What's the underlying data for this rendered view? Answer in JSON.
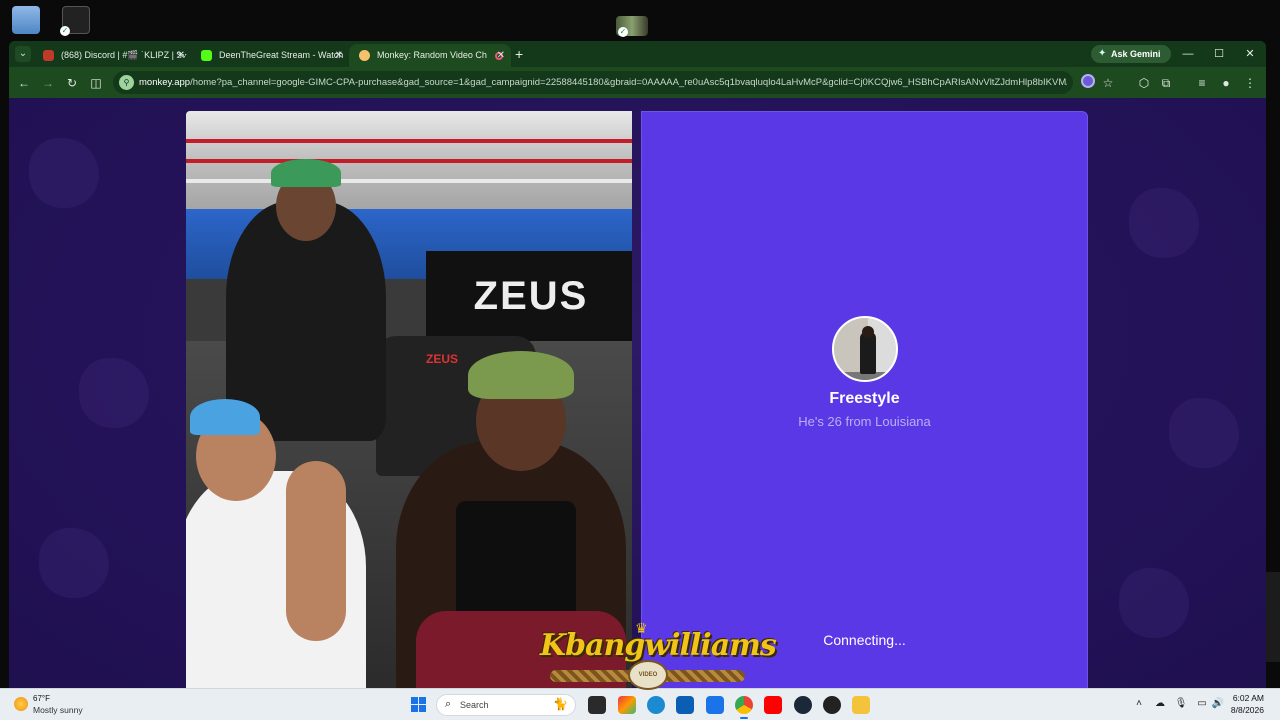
{
  "desktop": {
    "icons": [
      "recycle-bin-icon",
      "game-shortcut-icon",
      "video-thumbnail-icon"
    ]
  },
  "browser": {
    "tabs": [
      {
        "label": "(868) Discord | #🎬 ˙KLIPZ | Ꮥꭹ",
        "favicon_color": "#5865f2",
        "active": false
      },
      {
        "label": "DeenTheGreat Stream - Watch",
        "favicon_color": "#53fc18",
        "active": false
      },
      {
        "label": "Monkey: Random Video Ch",
        "favicon_color": "#f5c26b",
        "active": true
      }
    ],
    "new_tab": "+",
    "ask_gemini": "Ask Gemini",
    "url_host": "monkey.app",
    "url_path": "/home?pa_channel=google-GIMC-CPA-purchase&gad_source=1&gad_campaignid=22588445180&gbraid=0AAAAA_re0uAsc5q1bvaqluqlo4LaHvMcP&gclid=Cj0KCQjw6_HSBhCpARIsANvVltZJdmHlp8bIKVMAOeG...",
    "window_controls": {
      "minimize": "—",
      "maximize": "☐",
      "close": "✕"
    }
  },
  "monkey": {
    "match_name": "Freestyle",
    "match_bio": "He's 26 from Louisiana",
    "status": "Connecting...",
    "accent": "#5b38e6"
  },
  "overlay": {
    "watermark_text": "Kbangwilliams",
    "watermark_sub": "VIDEO"
  },
  "taskbar": {
    "weather_temp": "67°F",
    "weather_desc": "Mostly sunny",
    "search_placeholder": "Search",
    "time": "6:02 AM",
    "date": "8/8/2026"
  }
}
